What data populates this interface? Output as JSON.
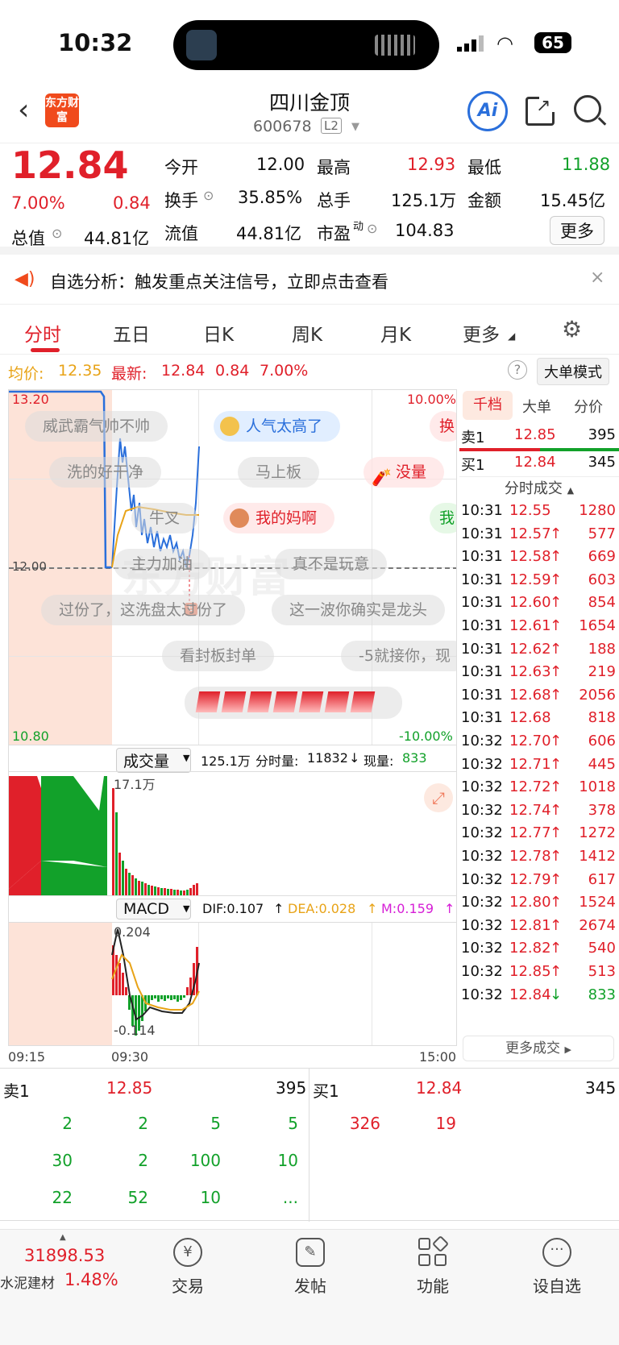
{
  "status": {
    "time": "10:32",
    "battery": "65"
  },
  "header": {
    "back_icon": "chevron-left-icon",
    "logo": "东方财富",
    "title": "四川金顶",
    "code": "600678",
    "level": "L2",
    "ai_label": "Ai"
  },
  "quote": {
    "price": "12.84",
    "change_pct": "7.00%",
    "change": "0.84",
    "open_label": "今开",
    "open": "12.00",
    "high_label": "最高",
    "high": "12.93",
    "low_label": "最低",
    "low": "11.88",
    "turnover_label": "换手",
    "turnover": "35.85%",
    "volume_label": "总手",
    "volume": "125.1万",
    "amount_label": "金额",
    "amount": "15.45亿",
    "mcap_label": "总值",
    "mcap": "44.81亿",
    "float_label": "流值",
    "float_mcap": "44.81亿",
    "pe_label": "市盈",
    "pe_sup": "动",
    "pe": "104.83",
    "more_button": "更多"
  },
  "notice": {
    "text": "自选分析：触发重点关注信号，立即点击查看"
  },
  "tabs": [
    "分时",
    "五日",
    "日K",
    "周K",
    "月K",
    "更多"
  ],
  "chart_info": {
    "avg_label": "均价:",
    "avg": "12.35",
    "last_label": "最新:",
    "last": "12.84",
    "change": "0.84",
    "pct": "7.00%",
    "bigorder_button": "大单模式"
  },
  "main_chart": {
    "ymax": "13.20",
    "ymin": "10.80",
    "pct_max": "10.00%",
    "pct_min": "-10.00%",
    "pre_close": "12.00",
    "danmu": [
      "威武霸气帅不帅",
      "人气太高了",
      "换",
      "洗的好干净",
      "马上板",
      "没量",
      "牛叉",
      "我的妈啊",
      "我",
      "主力加油",
      "真不是玩意",
      "过份了，这洗盘太过份了",
      "这一波你确实是龙头",
      "看封板封单",
      "-5就接你，现"
    ]
  },
  "volume": {
    "label": "成交量",
    "total": "125.1万",
    "minute_label": "分时量:",
    "minute": "11832",
    "now_label": "现量:",
    "now": "833",
    "max_label": "17.1万"
  },
  "macd": {
    "label": "MACD",
    "dif": "DIF:0.107",
    "dea": "DEA:0.028",
    "m": "M:0.159",
    "top": "0.204",
    "bottom": "-0.114"
  },
  "time_axis": {
    "start": "09:15",
    "mid": "09:30",
    "end": "15:00"
  },
  "right_tabs": [
    "千档",
    "大单",
    "分价"
  ],
  "right_book": {
    "sell_label": "卖1",
    "sell_price": "12.85",
    "sell_vol": "395",
    "buy_label": "买1",
    "buy_price": "12.84",
    "buy_vol": "345"
  },
  "trades_title": "分时成交",
  "trades": [
    {
      "t": "10:31",
      "p": "12.55",
      "a": "",
      "v": "1280"
    },
    {
      "t": "10:31",
      "p": "12.57",
      "a": "↑",
      "v": "577"
    },
    {
      "t": "10:31",
      "p": "12.58",
      "a": "↑",
      "v": "669"
    },
    {
      "t": "10:31",
      "p": "12.59",
      "a": "↑",
      "v": "603"
    },
    {
      "t": "10:31",
      "p": "12.60",
      "a": "↑",
      "v": "854"
    },
    {
      "t": "10:31",
      "p": "12.61",
      "a": "↑",
      "v": "1654"
    },
    {
      "t": "10:31",
      "p": "12.62",
      "a": "↑",
      "v": "188"
    },
    {
      "t": "10:31",
      "p": "12.63",
      "a": "↑",
      "v": "219"
    },
    {
      "t": "10:31",
      "p": "12.68",
      "a": "↑",
      "v": "2056"
    },
    {
      "t": "10:31",
      "p": "12.68",
      "a": "",
      "v": "818"
    },
    {
      "t": "10:32",
      "p": "12.70",
      "a": "↑",
      "v": "606"
    },
    {
      "t": "10:32",
      "p": "12.71",
      "a": "↑",
      "v": "445"
    },
    {
      "t": "10:32",
      "p": "12.72",
      "a": "↑",
      "v": "1018"
    },
    {
      "t": "10:32",
      "p": "12.74",
      "a": "↑",
      "v": "378"
    },
    {
      "t": "10:32",
      "p": "12.77",
      "a": "↑",
      "v": "1272"
    },
    {
      "t": "10:32",
      "p": "12.78",
      "a": "↑",
      "v": "1412"
    },
    {
      "t": "10:32",
      "p": "12.79",
      "a": "↑",
      "v": "617"
    },
    {
      "t": "10:32",
      "p": "12.80",
      "a": "↑",
      "v": "1524"
    },
    {
      "t": "10:32",
      "p": "12.81",
      "a": "↑",
      "v": "2674"
    },
    {
      "t": "10:32",
      "p": "12.82",
      "a": "↑",
      "v": "540"
    },
    {
      "t": "10:32",
      "p": "12.85",
      "a": "↑",
      "v": "513"
    },
    {
      "t": "10:32",
      "p": "12.84",
      "a": "↓",
      "v": "833"
    }
  ],
  "more_trades": "更多成交",
  "order_book": {
    "sell_label": "卖1",
    "sell_price": "12.85",
    "sell_vol": "395",
    "buy_label": "买1",
    "buy_price": "12.84",
    "buy_vol": "345",
    "sell_queue": [
      [
        "2",
        "2",
        "5",
        "5"
      ],
      [
        "30",
        "2",
        "100",
        "10"
      ],
      [
        "22",
        "52",
        "10",
        "..."
      ]
    ],
    "buy_queue": [
      "326",
      "19"
    ]
  },
  "bottom": {
    "index_value": "31898.53",
    "index_name": "水泥建材",
    "index_pct": "1.48%",
    "nav": [
      "交易",
      "发帖",
      "功能",
      "设自选"
    ]
  },
  "chart_data": {
    "type": "line",
    "title": "",
    "series": [
      {
        "name": "均价",
        "values": []
      }
    ],
    "x": [
      "09:15",
      "09:30",
      "15:00"
    ],
    "ylim": [
      10.8,
      13.2
    ]
  }
}
